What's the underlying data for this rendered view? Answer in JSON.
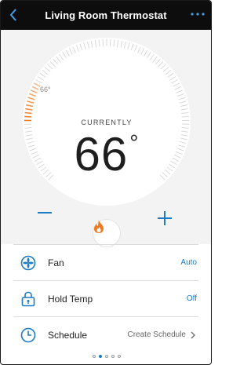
{
  "header": {
    "title": "Living Room Thermostat",
    "back_icon": "chevron-left-icon",
    "more_icon": "more-dots-icon"
  },
  "dial": {
    "setpoint_label": "66°",
    "currently_label": "CURRENTLY",
    "current_temp": "66",
    "degree_symbol": "°",
    "decrease_icon": "minus-icon",
    "increase_icon": "plus-icon",
    "mode_icon": "flame-icon"
  },
  "settings": [
    {
      "label": "Fan",
      "value": "Auto",
      "icon": "fan-icon",
      "chevron": false
    },
    {
      "label": "Hold Temp",
      "value": "Off",
      "icon": "lock-icon",
      "chevron": false
    },
    {
      "label": "Schedule",
      "value": "Create Schedule",
      "icon": "clock-icon",
      "chevron": true
    }
  ],
  "pagination": {
    "total": 5,
    "active": 1
  },
  "colors": {
    "header_bg": "#0d0d0d",
    "accent_blue": "#1b7bc4",
    "heat_orange": "#f07a22"
  }
}
